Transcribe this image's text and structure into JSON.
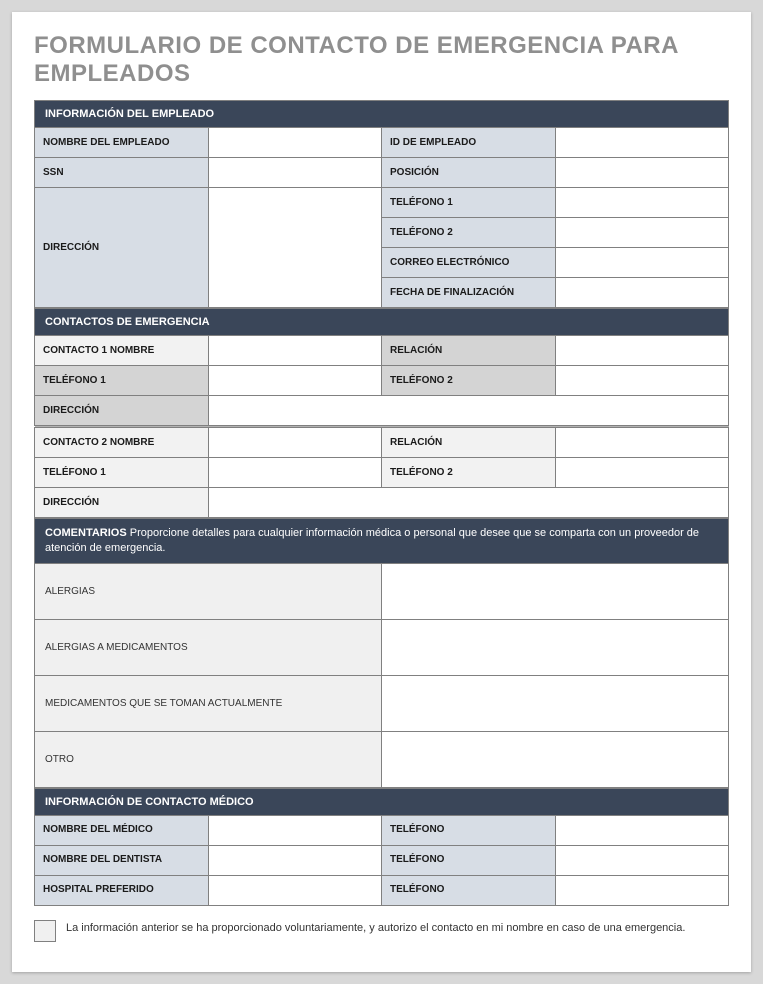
{
  "title": "FORMULARIO DE CONTACTO DE EMERGENCIA PARA EMPLEADOS",
  "sections": {
    "employee": {
      "header": "INFORMACIÓN DEL EMPLEADO",
      "name": "NOMBRE DEL EMPLEADO",
      "id": "ID DE EMPLEADO",
      "ssn": "SSN",
      "position": "POSICIÓN",
      "address": "DIRECCIÓN",
      "phone1": "TELÉFONO 1",
      "phone2": "TELÉFONO 2",
      "email": "CORREO ELECTRÓNICO",
      "enddate": "FECHA DE FINALIZACIÓN"
    },
    "emergency": {
      "header": "CONTACTOS DE EMERGENCIA",
      "c1name": "CONTACTO 1 NOMBRE",
      "relation": "RELACIÓN",
      "phone1": "TELÉFONO 1",
      "phone2": "TELÉFONO 2",
      "address": "DIRECCIÓN",
      "c2name": "CONTACTO 2 NOMBRE"
    },
    "comments": {
      "header_bold": "COMENTARIOS",
      "header_text": " Proporcione detalles para cualquier información médica o personal que desee que se comparta con un proveedor de atención de emergencia.",
      "allergies": "ALERGIAS",
      "med_allergies": "ALERGIAS A MEDICAMENTOS",
      "current_meds": "MEDICAMENTOS QUE SE TOMAN ACTUALMENTE",
      "other": "OTRO"
    },
    "medical": {
      "header": "INFORMACIÓN DE CONTACTO MÉDICO",
      "doctor": "NOMBRE DEL MÉDICO",
      "dentist": "NOMBRE DEL DENTISTA",
      "hospital": "HOSPITAL PREFERIDO",
      "phone": "TELÉFONO"
    }
  },
  "authorization": "La información anterior se ha proporcionado voluntariamente, y autorizo el contacto en mi nombre en caso de una emergencia."
}
